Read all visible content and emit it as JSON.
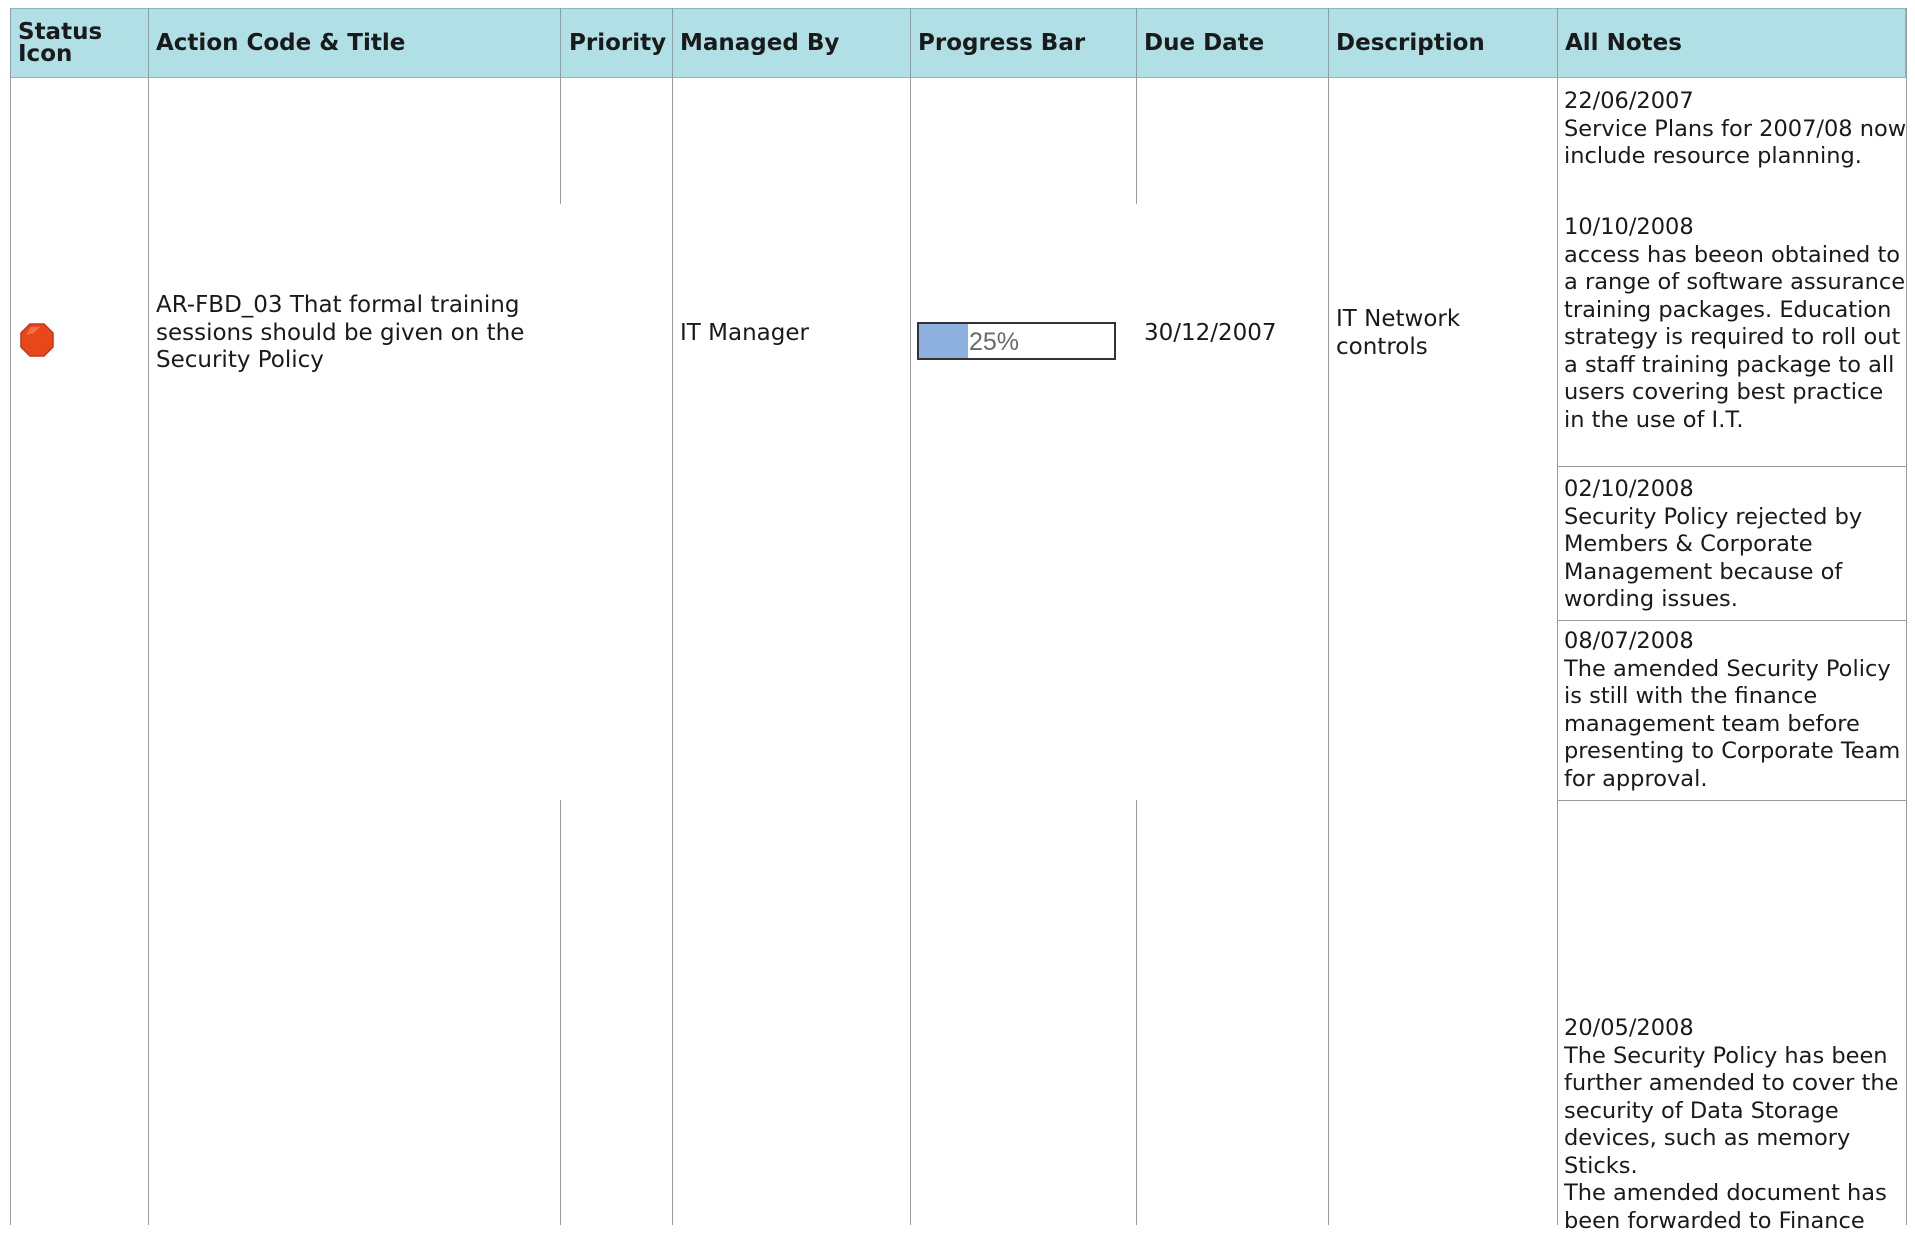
{
  "columns": {
    "status_icon": "Status Icon",
    "action_code_title": "Action Code & Title",
    "priority": "Priority",
    "managed_by": "Managed By",
    "progress_bar": "Progress Bar",
    "due_date": "Due Date",
    "description": "Description",
    "all_notes": "All Notes"
  },
  "row": {
    "status_color": "#e8471c",
    "status_icon_name": "red-octagon-icon",
    "action_title": "AR-FBD_03 That formal training sessions should be given on the Security Policy",
    "priority": "",
    "managed_by": "IT Manager",
    "progress_percent": 25,
    "progress_label": "25%",
    "progress_color": "#8eb0de",
    "due_date": "30/12/2007",
    "description": "IT Network controls",
    "notes": [
      {
        "date": "22/06/2007",
        "text": "Service Plans for 2007/08 now include resource planning."
      },
      {
        "date": "10/10/2008",
        "text": "access has beeon obtained to a range of software assurance training packages. Education strategy is required to roll out a staff training package to all users covering best practice in the use of I.T."
      },
      {
        "date": "02/10/2008",
        "text": "Security Policy rejected by Members & Corporate Management because of wording issues."
      },
      {
        "date": "08/07/2008",
        "text": "The amended Security Policy is still with the finance management team before presenting to Corporate Team for approval."
      },
      {
        "date": "20/05/2008",
        "text": "The Security Policy has been further amended to cover the security of Data Storage devices, such as memory Sticks.",
        "text2": "The amended document has been forwarded to Finance"
      }
    ]
  }
}
